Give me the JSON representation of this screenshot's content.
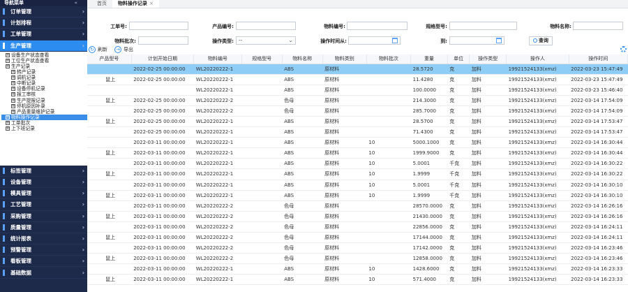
{
  "sidebar": {
    "title": "导航菜单",
    "collapse_icon": "double-chevron-left-icon",
    "top_menus": [
      {
        "label": "订单管理"
      },
      {
        "label": "计划排程"
      },
      {
        "label": "工单管理"
      },
      {
        "label": "生产管理"
      }
    ],
    "tree": [
      {
        "label": "设备生产状态查看",
        "level": 1
      },
      {
        "label": "工位生产状态查看",
        "level": 1
      },
      {
        "label": "生产记录",
        "level": 1
      },
      {
        "label": "转产记录",
        "level": 2
      },
      {
        "label": "调机记录",
        "level": 2
      },
      {
        "label": "中断记录",
        "level": 2
      },
      {
        "label": "设备停机记录",
        "level": 2
      },
      {
        "label": "报工审核",
        "level": 2
      },
      {
        "label": "生产提报记录",
        "level": 2
      },
      {
        "label": "停机原因补录",
        "level": 2
      },
      {
        "label": "产品重量维护记录",
        "level": 2
      },
      {
        "label": "物料操作记录",
        "level": 1
      },
      {
        "label": "工单批次",
        "level": 1
      },
      {
        "label": "上下班记录",
        "level": 1
      }
    ],
    "bottom_menus": [
      {
        "label": "标签管理"
      },
      {
        "label": "设备管理"
      },
      {
        "label": "模具管理"
      },
      {
        "label": "工艺管理"
      },
      {
        "label": "采购管理"
      },
      {
        "label": "质量管理"
      },
      {
        "label": "统计报表"
      },
      {
        "label": "预警管理"
      },
      {
        "label": "看板管理"
      },
      {
        "label": "基础数据"
      }
    ]
  },
  "tabs": [
    {
      "label": "首页"
    },
    {
      "label": "物料操作记录",
      "close": "×"
    }
  ],
  "search": {
    "work_order_label": "工单号:",
    "work_order_value": "",
    "product_code_label": "产品编号:",
    "product_code_value": "",
    "material_code_label": "物料编号:",
    "material_code_value": "",
    "spec_label": "规格型号:",
    "spec_value": "",
    "material_name_label": "物料名称:",
    "material_name_value": "",
    "batch_label": "物料批次:",
    "batch_value": "",
    "op_type_label": "操作类型:",
    "op_type_value": "--",
    "time_from_label": "操作时间从:",
    "time_from_value": "",
    "time_to_label": "到:",
    "time_to_value": "",
    "query_label": "查询"
  },
  "toolbar": {
    "refresh_label": "刷新",
    "export_label": "导出"
  },
  "table": {
    "columns": [
      "产品型号",
      "计划开始日期",
      "物料编号",
      "规格型号",
      "物料名称",
      "物料类别",
      "物料批次",
      "重量",
      "单位",
      "操作类型",
      "操作人",
      "操作时间"
    ],
    "rows": [
      [
        "",
        "2022-02-25 00:00:00",
        "WL20220222-1",
        "",
        "ABS",
        "原材料",
        "",
        "28.5720",
        "克",
        "加料",
        "19921524133(xmz)",
        "2022-03-23 15:47:49"
      ],
      [
        "鼠上",
        "2022-02-25 00:00:00",
        "WL20220222-1",
        "",
        "ABS",
        "原材料",
        "",
        "11.4280",
        "克",
        "加料",
        "19921524133(xmz)",
        "2022-03-23 15:47:49"
      ],
      [
        "",
        "",
        "WL20220222-1",
        "",
        "ABS",
        "原材料",
        "",
        "100.0000",
        "克",
        "加料",
        "19921524133(xmz)",
        "2022-03-23 15:46:40"
      ],
      [
        "鼠上",
        "2022-02-25 00:00:00",
        "WL20220222-2",
        "",
        "色母",
        "原材料",
        "",
        "214.3000",
        "克",
        "加料",
        "19921524133(xmz)",
        "2022-03-14 17:54:09"
      ],
      [
        "",
        "2022-02-25 00:00:00",
        "WL20220222-2",
        "",
        "色母",
        "原材料",
        "",
        "285.7000",
        "克",
        "加料",
        "19921524133(xmz)",
        "2022-03-14 17:54:09"
      ],
      [
        "鼠上",
        "2022-02-25 00:00:00",
        "WL20220222-1",
        "",
        "ABS",
        "原材料",
        "",
        "28.5700",
        "克",
        "加料",
        "19921524133(xmz)",
        "2022-03-14 17:53:47"
      ],
      [
        "",
        "2022-02-25 00:00:00",
        "WL20220222-1",
        "",
        "ABS",
        "原材料",
        "",
        "71.4300",
        "克",
        "加料",
        "19921524133(xmz)",
        "2022-03-14 17:53:47"
      ],
      [
        "",
        "2022-03-11 00:00:00",
        "WL20220222-1",
        "",
        "ABS",
        "原材料",
        "10",
        "5000.1000",
        "克",
        "加料",
        "19921524133(xmz)",
        "2022-03-14 16:30:44"
      ],
      [
        "鼠上",
        "2022-03-11 00:00:00",
        "WL20220222-1",
        "",
        "ABS",
        "原材料",
        "10",
        "1999.9000",
        "克",
        "加料",
        "19921524133(xmz)",
        "2022-03-14 16:30:44"
      ],
      [
        "",
        "2022-03-11 00:00:00",
        "WL20220222-1",
        "",
        "ABS",
        "原材料",
        "10",
        "5.0001",
        "千克",
        "加料",
        "19921524133(xmz)",
        "2022-03-14 16:30:22"
      ],
      [
        "鼠上",
        "2022-03-11 00:00:00",
        "WL20220222-1",
        "",
        "ABS",
        "原材料",
        "10",
        "1.9999",
        "千克",
        "加料",
        "19921524133(xmz)",
        "2022-03-14 16:30:22"
      ],
      [
        "",
        "2022-03-11 00:00:00",
        "WL20220222-1",
        "",
        "ABS",
        "原材料",
        "10",
        "5.0001",
        "千克",
        "加料",
        "19921524133(xmz)",
        "2022-03-14 16:30:10"
      ],
      [
        "鼠上",
        "2022-03-11 00:00:00",
        "WL20220222-1",
        "",
        "ABS",
        "原材料",
        "10",
        "1.9999",
        "千克",
        "加料",
        "19921524133(xmz)",
        "2022-03-14 16:30:10"
      ],
      [
        "",
        "2022-03-11 00:00:00",
        "WL20220222-2",
        "",
        "色母",
        "原材料",
        "",
        "28570.0000",
        "克",
        "加料",
        "19921524133(xmz)",
        "2022-03-14 16:26:16"
      ],
      [
        "鼠上",
        "2022-03-11 00:00:00",
        "WL20220222-2",
        "",
        "色母",
        "原材料",
        "",
        "21430.0000",
        "克",
        "加料",
        "19921524133(xmz)",
        "2022-03-14 16:26:16"
      ],
      [
        "",
        "2022-03-11 00:00:00",
        "WL20220222-2",
        "",
        "色母",
        "原材料",
        "",
        "22856.0000",
        "克",
        "加料",
        "19921524133(xmz)",
        "2022-03-14 16:24:11"
      ],
      [
        "鼠上",
        "2022-03-11 00:00:00",
        "WL20220222-2",
        "",
        "色母",
        "原材料",
        "",
        "17144.0000",
        "克",
        "加料",
        "19921524133(xmz)",
        "2022-03-14 16:24:11"
      ],
      [
        "",
        "2022-03-11 00:00:00",
        "WL20220222-2",
        "",
        "色母",
        "原材料",
        "",
        "17142.0000",
        "克",
        "加料",
        "19921524133(xmz)",
        "2022-03-14 16:23:46"
      ],
      [
        "鼠上",
        "2022-03-11 00:00:00",
        "WL20220222-2",
        "",
        "色母",
        "原材料",
        "",
        "12858.0000",
        "克",
        "加料",
        "19921524133(xmz)",
        "2022-03-14 16:23:46"
      ],
      [
        "",
        "2022-03-11 00:00:00",
        "WL20220222-1",
        "",
        "ABS",
        "原材料",
        "10",
        "1428.6000",
        "克",
        "加料",
        "19921524133(xmz)",
        "2022-03-14 16:23:33"
      ],
      [
        "鼠上",
        "2022-03-11 00:00:00",
        "WL20220222-1",
        "",
        "ABS",
        "原材料",
        "10",
        "571.4000",
        "克",
        "加料",
        "19921524133(xmz)",
        "2022-03-14 16:23:33"
      ]
    ]
  }
}
